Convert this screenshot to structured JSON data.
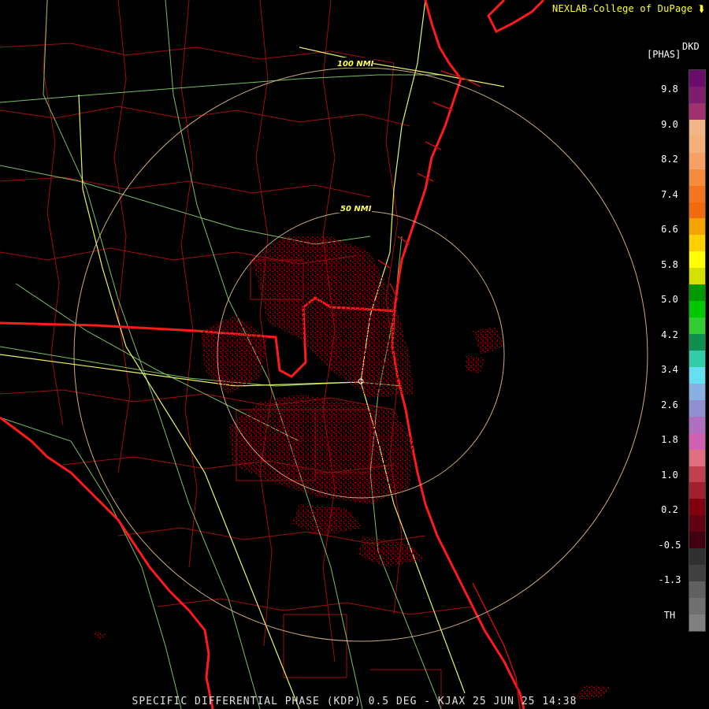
{
  "header": {
    "credit": "NEXLAB-College of DuPage",
    "logo_icon": "cod-logo-icon"
  },
  "product": {
    "footer": "SPECIFIC DIFFERENTIAL PHASE (KDP) 0.5 DEG - KJAX 25 JUN 25 14:38"
  },
  "legend": {
    "unit_line1": "DKD",
    "unit_line2": "[PHAS]",
    "labels": [
      "9.8",
      "9.0",
      "8.2",
      "7.4",
      "6.6",
      "5.8",
      "5.0",
      "4.2",
      "3.4",
      "2.6",
      "1.8",
      "1.0",
      "0.2",
      "-0.5",
      "-1.3",
      "TH"
    ],
    "colors": [
      "#6a0d6a",
      "#7e1c6e",
      "#a03070",
      "#f3b584",
      "#f5b07a",
      "#f7a066",
      "#f78b3c",
      "#f57420",
      "#f26a10",
      "#f5a300",
      "#ffd000",
      "#ffff00",
      "#d6e000",
      "#009900",
      "#00c800",
      "#33cc33",
      "#0f8f4f",
      "#33ccaa",
      "#66e0f0",
      "#88b0e0",
      "#9090d0",
      "#b070c0",
      "#d060b0",
      "#e07080",
      "#c04050",
      "#a02030",
      "#800010",
      "#600010",
      "#400010",
      "#303030",
      "#404040",
      "#606060",
      "#707070",
      "#808080"
    ]
  },
  "range_rings": [
    "50 NMI",
    "100 NMI"
  ],
  "colors": {
    "radar_echo": "#7a0000",
    "state_border": "#ff1a1a",
    "county_border": "#c01010",
    "highway": "#90e070",
    "ring": "#f0c890"
  }
}
